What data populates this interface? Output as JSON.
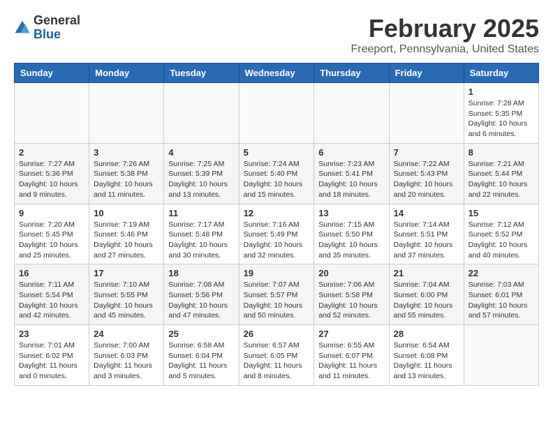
{
  "header": {
    "logo_general": "General",
    "logo_blue": "Blue",
    "month_title": "February 2025",
    "location": "Freeport, Pennsylvania, United States"
  },
  "weekdays": [
    "Sunday",
    "Monday",
    "Tuesday",
    "Wednesday",
    "Thursday",
    "Friday",
    "Saturday"
  ],
  "weeks": [
    [
      {
        "day": "",
        "info": ""
      },
      {
        "day": "",
        "info": ""
      },
      {
        "day": "",
        "info": ""
      },
      {
        "day": "",
        "info": ""
      },
      {
        "day": "",
        "info": ""
      },
      {
        "day": "",
        "info": ""
      },
      {
        "day": "1",
        "info": "Sunrise: 7:28 AM\nSunset: 5:35 PM\nDaylight: 10 hours and 6 minutes."
      }
    ],
    [
      {
        "day": "2",
        "info": "Sunrise: 7:27 AM\nSunset: 5:36 PM\nDaylight: 10 hours and 9 minutes."
      },
      {
        "day": "3",
        "info": "Sunrise: 7:26 AM\nSunset: 5:38 PM\nDaylight: 10 hours and 11 minutes."
      },
      {
        "day": "4",
        "info": "Sunrise: 7:25 AM\nSunset: 5:39 PM\nDaylight: 10 hours and 13 minutes."
      },
      {
        "day": "5",
        "info": "Sunrise: 7:24 AM\nSunset: 5:40 PM\nDaylight: 10 hours and 15 minutes."
      },
      {
        "day": "6",
        "info": "Sunrise: 7:23 AM\nSunset: 5:41 PM\nDaylight: 10 hours and 18 minutes."
      },
      {
        "day": "7",
        "info": "Sunrise: 7:22 AM\nSunset: 5:43 PM\nDaylight: 10 hours and 20 minutes."
      },
      {
        "day": "8",
        "info": "Sunrise: 7:21 AM\nSunset: 5:44 PM\nDaylight: 10 hours and 22 minutes."
      }
    ],
    [
      {
        "day": "9",
        "info": "Sunrise: 7:20 AM\nSunset: 5:45 PM\nDaylight: 10 hours and 25 minutes."
      },
      {
        "day": "10",
        "info": "Sunrise: 7:19 AM\nSunset: 5:46 PM\nDaylight: 10 hours and 27 minutes."
      },
      {
        "day": "11",
        "info": "Sunrise: 7:17 AM\nSunset: 5:48 PM\nDaylight: 10 hours and 30 minutes."
      },
      {
        "day": "12",
        "info": "Sunrise: 7:16 AM\nSunset: 5:49 PM\nDaylight: 10 hours and 32 minutes."
      },
      {
        "day": "13",
        "info": "Sunrise: 7:15 AM\nSunset: 5:50 PM\nDaylight: 10 hours and 35 minutes."
      },
      {
        "day": "14",
        "info": "Sunrise: 7:14 AM\nSunset: 5:51 PM\nDaylight: 10 hours and 37 minutes."
      },
      {
        "day": "15",
        "info": "Sunrise: 7:12 AM\nSunset: 5:52 PM\nDaylight: 10 hours and 40 minutes."
      }
    ],
    [
      {
        "day": "16",
        "info": "Sunrise: 7:11 AM\nSunset: 5:54 PM\nDaylight: 10 hours and 42 minutes."
      },
      {
        "day": "17",
        "info": "Sunrise: 7:10 AM\nSunset: 5:55 PM\nDaylight: 10 hours and 45 minutes."
      },
      {
        "day": "18",
        "info": "Sunrise: 7:08 AM\nSunset: 5:56 PM\nDaylight: 10 hours and 47 minutes."
      },
      {
        "day": "19",
        "info": "Sunrise: 7:07 AM\nSunset: 5:57 PM\nDaylight: 10 hours and 50 minutes."
      },
      {
        "day": "20",
        "info": "Sunrise: 7:06 AM\nSunset: 5:58 PM\nDaylight: 10 hours and 52 minutes."
      },
      {
        "day": "21",
        "info": "Sunrise: 7:04 AM\nSunset: 6:00 PM\nDaylight: 10 hours and 55 minutes."
      },
      {
        "day": "22",
        "info": "Sunrise: 7:03 AM\nSunset: 6:01 PM\nDaylight: 10 hours and 57 minutes."
      }
    ],
    [
      {
        "day": "23",
        "info": "Sunrise: 7:01 AM\nSunset: 6:02 PM\nDaylight: 11 hours and 0 minutes."
      },
      {
        "day": "24",
        "info": "Sunrise: 7:00 AM\nSunset: 6:03 PM\nDaylight: 11 hours and 3 minutes."
      },
      {
        "day": "25",
        "info": "Sunrise: 6:58 AM\nSunset: 6:04 PM\nDaylight: 11 hours and 5 minutes."
      },
      {
        "day": "26",
        "info": "Sunrise: 6:57 AM\nSunset: 6:05 PM\nDaylight: 11 hours and 8 minutes."
      },
      {
        "day": "27",
        "info": "Sunrise: 6:55 AM\nSunset: 6:07 PM\nDaylight: 11 hours and 11 minutes."
      },
      {
        "day": "28",
        "info": "Sunrise: 6:54 AM\nSunset: 6:08 PM\nDaylight: 11 hours and 13 minutes."
      },
      {
        "day": "",
        "info": ""
      }
    ]
  ]
}
